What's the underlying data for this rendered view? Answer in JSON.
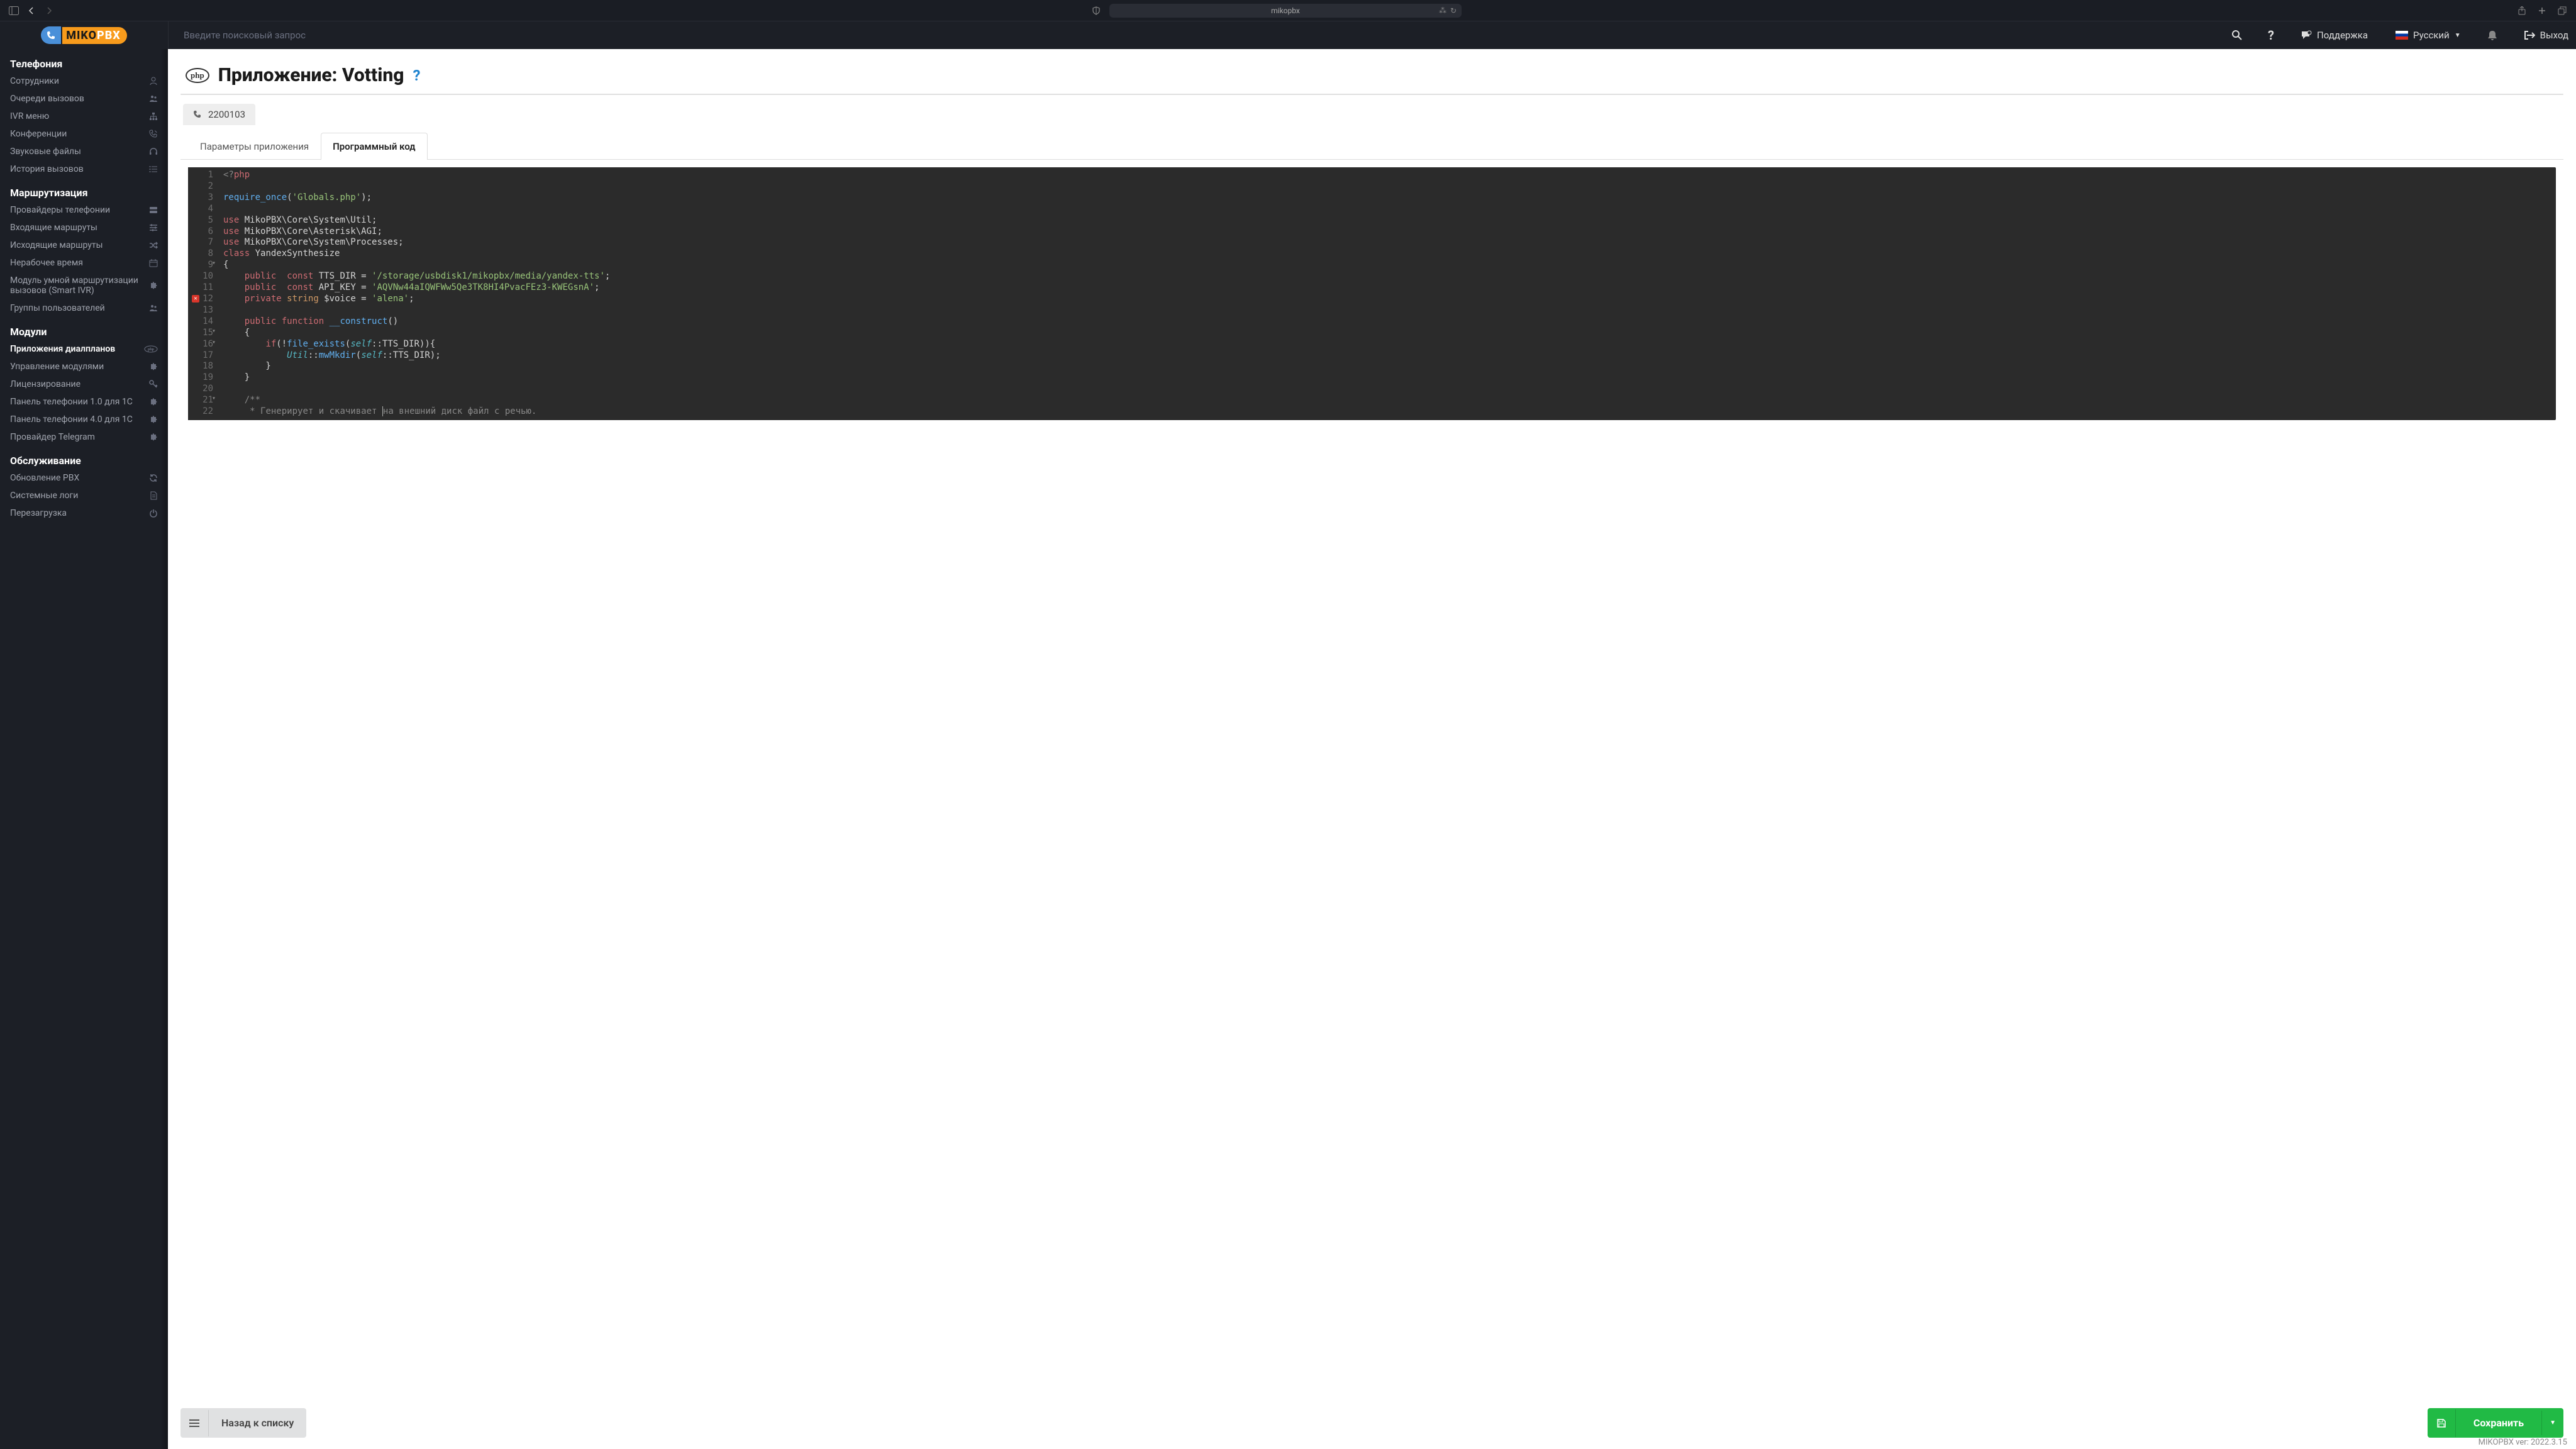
{
  "browser": {
    "url": "mikopbx"
  },
  "header": {
    "search_placeholder": "Введите поисковый запрос",
    "support": "Поддержка",
    "language": "Русский",
    "logout": "Выход"
  },
  "sidebar": {
    "sections": [
      {
        "title": "Телефония",
        "items": [
          {
            "label": "Сотрудники",
            "icon": "user"
          },
          {
            "label": "Очереди вызовов",
            "icon": "users"
          },
          {
            "label": "IVR меню",
            "icon": "sitemap"
          },
          {
            "label": "Конференции",
            "icon": "phone"
          },
          {
            "label": "Звуковые файлы",
            "icon": "headphones"
          },
          {
            "label": "История вызовов",
            "icon": "list"
          }
        ]
      },
      {
        "title": "Маршрутизация",
        "items": [
          {
            "label": "Провайдеры телефонии",
            "icon": "server"
          },
          {
            "label": "Входящие маршруты",
            "icon": "sliders"
          },
          {
            "label": "Исходящие маршруты",
            "icon": "random"
          },
          {
            "label": "Нерабочее время",
            "icon": "calendar"
          },
          {
            "label": "Модуль умной маршрутизации вызовов (Smart IVR)",
            "icon": "puzzle"
          },
          {
            "label": "Группы пользователей",
            "icon": "users"
          }
        ]
      },
      {
        "title": "Модули",
        "items": [
          {
            "label": "Приложения диалпланов",
            "icon": "php",
            "active": true
          },
          {
            "label": "Управление модулями",
            "icon": "puzzle"
          },
          {
            "label": "Лицензирование",
            "icon": "key"
          },
          {
            "label": "Панель телефонии 1.0 для 1С",
            "icon": "puzzle"
          },
          {
            "label": "Панель телефонии 4.0 для 1С",
            "icon": "puzzle"
          },
          {
            "label": "Провайдер Telegram",
            "icon": "puzzle"
          }
        ]
      },
      {
        "title": "Обслуживание",
        "items": [
          {
            "label": "Обновление PBX",
            "icon": "sync"
          },
          {
            "label": "Системные логи",
            "icon": "file"
          },
          {
            "label": "Перезагрузка",
            "icon": "power"
          }
        ]
      }
    ]
  },
  "page": {
    "badge": "php",
    "title": "Приложение: Votting",
    "extension": "2200103",
    "tabs": [
      {
        "label": "Параметры приложения",
        "active": false
      },
      {
        "label": "Программный код",
        "active": true
      }
    ],
    "back_button": "Назад к списку",
    "save_button": "Сохранить"
  },
  "code": {
    "lines": [
      {
        "n": 1,
        "tokens": [
          [
            "gray",
            "<?"
          ],
          [
            "red",
            "php"
          ]
        ]
      },
      {
        "n": 2,
        "tokens": []
      },
      {
        "n": 3,
        "tokens": [
          [
            "blue",
            "require_once"
          ],
          [
            "plain",
            "("
          ],
          [
            "green",
            "'Globals.php'"
          ],
          [
            "plain",
            ");"
          ]
        ]
      },
      {
        "n": 4,
        "tokens": []
      },
      {
        "n": 5,
        "tokens": [
          [
            "red",
            "use"
          ],
          [
            "plain",
            " MikoPBX\\Core\\System\\Util;"
          ]
        ]
      },
      {
        "n": 6,
        "tokens": [
          [
            "red",
            "use"
          ],
          [
            "plain",
            " MikoPBX\\Core\\Asterisk\\AGI;"
          ]
        ]
      },
      {
        "n": 7,
        "tokens": [
          [
            "red",
            "use"
          ],
          [
            "plain",
            " MikoPBX\\Core\\System\\Processes;"
          ]
        ]
      },
      {
        "n": 8,
        "tokens": [
          [
            "red",
            "class"
          ],
          [
            "plain",
            " YandexSynthesize"
          ]
        ]
      },
      {
        "n": 9,
        "fold": true,
        "tokens": [
          [
            "plain",
            "{"
          ]
        ]
      },
      {
        "n": 10,
        "tokens": [
          [
            "plain",
            "    "
          ],
          [
            "red",
            "public"
          ],
          [
            "plain",
            "  "
          ],
          [
            "red",
            "const"
          ],
          [
            "plain",
            " TTS_DIR = "
          ],
          [
            "green",
            "'/storage/usbdisk1/mikopbx/media/yandex-tts'"
          ],
          [
            "plain",
            ";"
          ]
        ]
      },
      {
        "n": 11,
        "tokens": [
          [
            "plain",
            "    "
          ],
          [
            "red",
            "public"
          ],
          [
            "plain",
            "  "
          ],
          [
            "red",
            "const"
          ],
          [
            "plain",
            " API_KEY = "
          ],
          [
            "green",
            "'AQVNw44aIQWFWw5Qe3TK8HI4PvacFEz3-KWEGsnA'"
          ],
          [
            "plain",
            ";"
          ]
        ]
      },
      {
        "n": 12,
        "error": true,
        "tokens": [
          [
            "plain",
            "    "
          ],
          [
            "red",
            "private"
          ],
          [
            "plain",
            " "
          ],
          [
            "orange",
            "string"
          ],
          [
            "plain",
            " $voice = "
          ],
          [
            "green",
            "'alena'"
          ],
          [
            "plain",
            ";"
          ]
        ]
      },
      {
        "n": 13,
        "tokens": []
      },
      {
        "n": 14,
        "tokens": [
          [
            "plain",
            "    "
          ],
          [
            "red",
            "public"
          ],
          [
            "plain",
            " "
          ],
          [
            "red",
            "function"
          ],
          [
            "plain",
            " "
          ],
          [
            "blue",
            "__construct"
          ],
          [
            "plain",
            "()"
          ]
        ]
      },
      {
        "n": 15,
        "fold": true,
        "tokens": [
          [
            "plain",
            "    {"
          ]
        ]
      },
      {
        "n": 16,
        "fold": true,
        "tokens": [
          [
            "plain",
            "        "
          ],
          [
            "red",
            "if"
          ],
          [
            "plain",
            "(!"
          ],
          [
            "blue",
            "file_exists"
          ],
          [
            "plain",
            "("
          ],
          [
            "teal",
            "self"
          ],
          [
            "plain",
            "::TTS_DIR)){"
          ]
        ]
      },
      {
        "n": 17,
        "tokens": [
          [
            "plain",
            "            "
          ],
          [
            "teal",
            "Util"
          ],
          [
            "plain",
            "::"
          ],
          [
            "blue",
            "mwMkdir"
          ],
          [
            "plain",
            "("
          ],
          [
            "teal",
            "self"
          ],
          [
            "plain",
            "::TTS_DIR);"
          ]
        ]
      },
      {
        "n": 18,
        "tokens": [
          [
            "plain",
            "        }"
          ]
        ]
      },
      {
        "n": 19,
        "tokens": [
          [
            "plain",
            "    }"
          ]
        ]
      },
      {
        "n": 20,
        "tokens": []
      },
      {
        "n": 21,
        "fold": true,
        "tokens": [
          [
            "plain",
            "    "
          ],
          [
            "gray",
            "/**"
          ]
        ]
      },
      {
        "n": 22,
        "cursor": 32,
        "tokens": [
          [
            "plain",
            "     "
          ],
          [
            "gray",
            "* Генерирует и скачивает "
          ],
          [
            "gray-cursor",
            "н"
          ],
          [
            "gray",
            "а внешний диск файл с речью."
          ]
        ]
      }
    ]
  },
  "footer": {
    "version": "MIKOPBX ver: 2022.3.15"
  }
}
